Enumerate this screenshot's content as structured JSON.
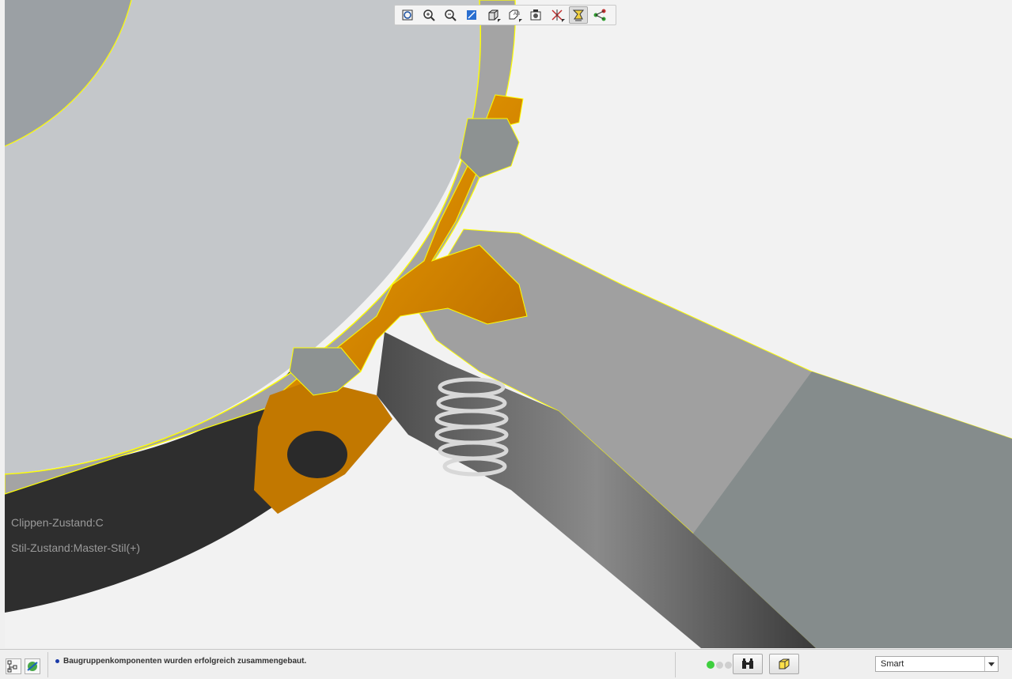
{
  "viewport": {
    "clip_state": "Clippen-Zustand:C",
    "style_state": "Stil-Zustand:Master-Stil(+)",
    "colors": {
      "background": "#f2f2f2",
      "cut_face": "#a8a8a8",
      "highlight_part": "#f0a000",
      "edge_highlight": "#ffff00"
    }
  },
  "toolbar": {
    "buttons": [
      {
        "icon": "zoom-fit-icon",
        "active": false
      },
      {
        "icon": "zoom-in-icon",
        "active": false
      },
      {
        "icon": "zoom-out-icon",
        "active": false
      },
      {
        "icon": "repaint-icon",
        "active": false
      },
      {
        "icon": "display-style-icon",
        "active": false,
        "dropdown": true
      },
      {
        "icon": "saved-views-icon",
        "active": false,
        "dropdown": true
      },
      {
        "icon": "view-manager-icon",
        "active": false
      },
      {
        "icon": "datum-display-icon",
        "active": false,
        "dropdown": true
      },
      {
        "icon": "annotation-display-icon",
        "active": true
      },
      {
        "icon": "spin-center-icon",
        "active": false
      }
    ]
  },
  "statusbar": {
    "message": "Baugruppenkomponenten wurden erfolgreich zusammengebaut.",
    "filter_value": "Smart",
    "colors": {
      "message_dot": "#1a3aa8",
      "status_light": "#3ecf3e"
    }
  }
}
